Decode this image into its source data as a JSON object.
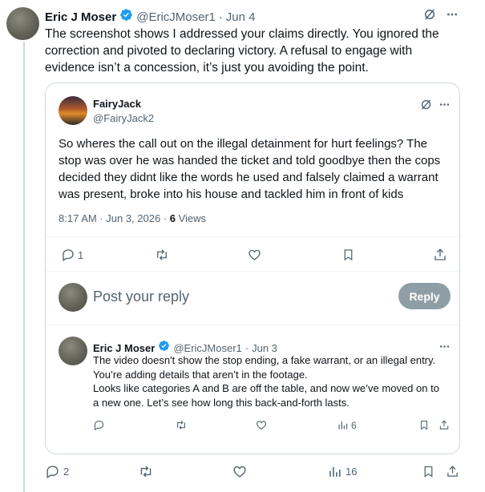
{
  "main_post": {
    "author_name": "Eric J Moser",
    "handle": "@EricJMoser1",
    "date": "Jun 4",
    "text_lines": [
      "The screenshot shows I addressed your claims directly. You ignored the",
      "correction and pivoted to declaring victory. A refusal to engage with",
      "evidence isn’t a concession, it’s just you avoiding the point."
    ],
    "replies_count": "2",
    "views_count": "16"
  },
  "quoted_post": {
    "author_name": "FairyJack",
    "handle": "@FairyJack2",
    "text_lines": [
      "So wheres the call out on the illegal detainment for hurt feelings? The",
      "stop was over he was handed the ticket and told goodbye then the cops",
      "decided they didnt like the words he used and falsely claimed a warrant",
      "was present, broke into his house and tackled him in front of kids"
    ],
    "timestamp": "8:17 AM · Jun 3, 2026 · ",
    "views_number": "6",
    "views_label": " Views",
    "replies_count": "1"
  },
  "composer": {
    "placeholder": "Post your reply",
    "reply_button": "Reply"
  },
  "nested_reply": {
    "author_name": "Eric J Moser",
    "handle": "@EricJMoser1",
    "date": "Jun 3",
    "text_lines": [
      "The video doesn't show the stop ending, a fake warrant, or an illegal entry.",
      "You’re adding details that aren’t in the footage.",
      "Looks like categories A and B are off the table, and now we’ve moved on to",
      "a new one. Let’s see how long this back-and-forth lasts."
    ],
    "views_count": "6"
  },
  "colors": {
    "verified": "#1d9bf0",
    "muted": "#536471",
    "border": "#cfd9de",
    "reply_button_bg": "#8f9ea6"
  },
  "icons": [
    "verified-badge-icon",
    "grok-icon",
    "more-icon",
    "reply-icon",
    "repost-icon",
    "like-icon",
    "views-icon",
    "bookmark-icon",
    "share-icon"
  ]
}
